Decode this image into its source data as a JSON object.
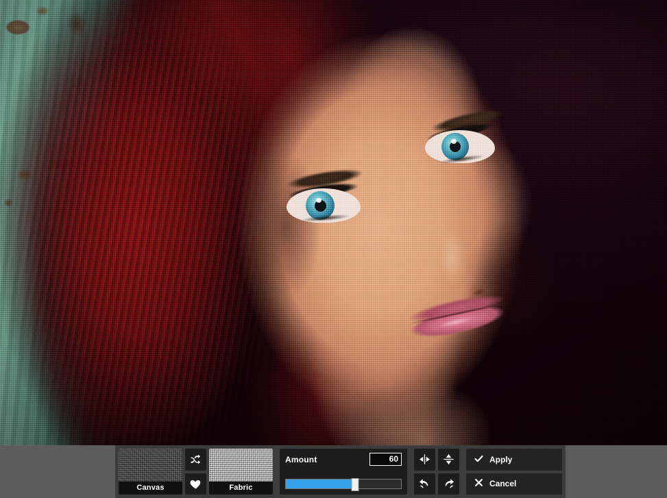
{
  "app": {
    "background_color": "#5c5c5c",
    "panel_color": "#3c3c3c",
    "button_color": "#232323",
    "accent_color": "#35a1e8"
  },
  "photo": {
    "name": "portrait-with-canvas-texture",
    "description": "Close-up portrait of a woman with red hair and blue eyes against a weathered teal wall, with a canvas texture filter applied"
  },
  "toolbar": {
    "textures": [
      {
        "id": "canvas",
        "label": "Canvas",
        "swatch": "#585858",
        "selected": true
      },
      {
        "id": "fabric",
        "label": "Fabric",
        "swatch": "#c9c9c9",
        "selected": false
      }
    ],
    "texture_tools": [
      {
        "id": "shuffle",
        "icon": "shuffle-icon",
        "title": "Shuffle"
      },
      {
        "id": "favorite",
        "icon": "heart-icon",
        "title": "Favorite"
      }
    ],
    "amount": {
      "label": "Amount",
      "value": "60",
      "min": 0,
      "max": 100,
      "percent": 60
    },
    "transform_tools": [
      {
        "id": "flip-horizontal",
        "icon": "flip-horizontal-icon",
        "title": "Flip Horizontal"
      },
      {
        "id": "flip-vertical",
        "icon": "flip-vertical-icon",
        "title": "Flip Vertical"
      },
      {
        "id": "undo",
        "icon": "undo-icon",
        "title": "Undo"
      },
      {
        "id": "redo",
        "icon": "redo-icon",
        "title": "Redo"
      }
    ],
    "actions": [
      {
        "id": "apply",
        "label": "Apply",
        "icon": "check-icon"
      },
      {
        "id": "cancel",
        "label": "Cancel",
        "icon": "close-icon"
      }
    ]
  }
}
